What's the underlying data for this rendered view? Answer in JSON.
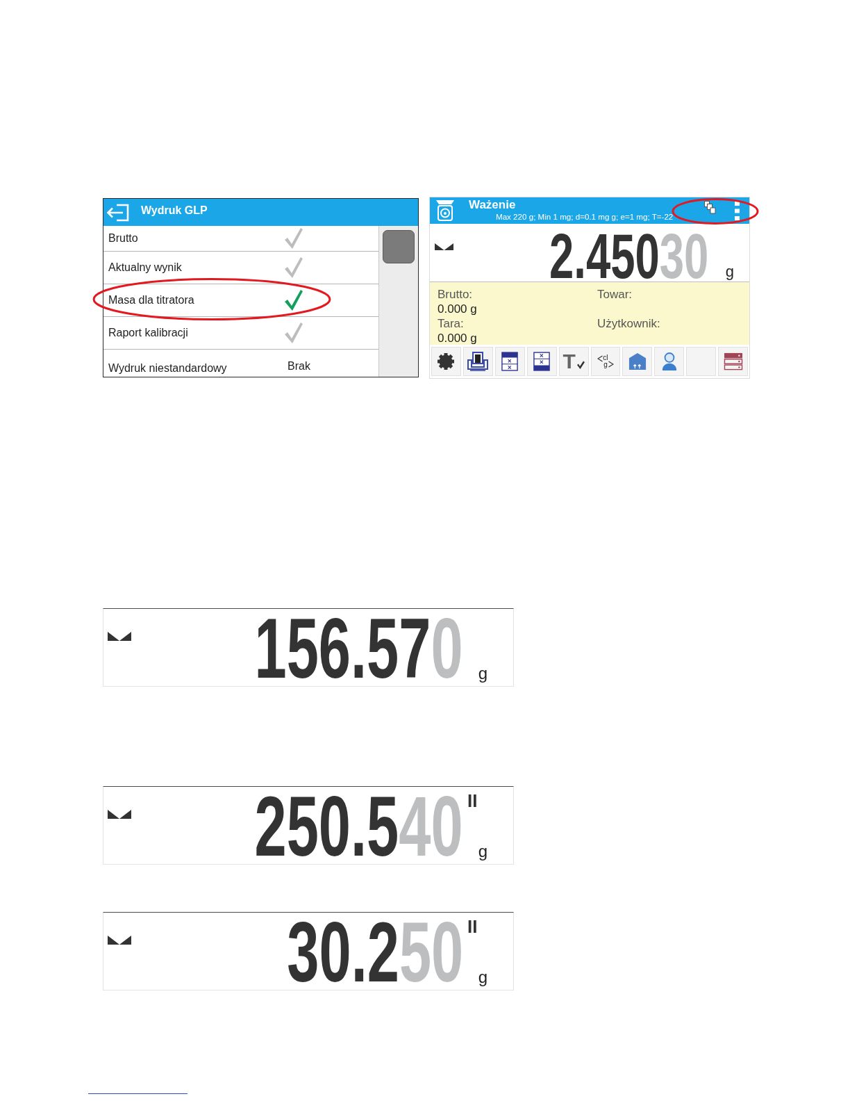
{
  "glp_screen": {
    "title": "Wydruk GLP",
    "items": [
      {
        "kind": "check",
        "label": "Brutto",
        "checked": false,
        "highlighted": false
      },
      {
        "kind": "check",
        "label": "Aktualny wynik",
        "checked": false,
        "highlighted": false
      },
      {
        "kind": "check",
        "label": "Masa dla titratora",
        "checked": true,
        "highlighted": true
      },
      {
        "kind": "check",
        "label": "Raport kalibracji",
        "checked": false,
        "highlighted": false
      },
      {
        "kind": "value",
        "label": "Wydruk niestandardowy",
        "value": "Brak",
        "highlighted": false
      }
    ]
  },
  "weighing_screen": {
    "title": "Ważenie",
    "subtitle": "Max 220 g; Min 1 mg; d=0.1 mg g; e=1 mg; T=-22",
    "header_icons_highlighted": true,
    "reading": {
      "main": "2.450",
      "extra": "30",
      "unit": "g"
    },
    "info": [
      {
        "label": "Brutto:",
        "value": "0.000 g"
      },
      {
        "label": "Towar:"
      },
      {
        "label": "Tara:",
        "value": "0.000 g"
      },
      {
        "label": "Użytkownik:"
      }
    ],
    "toolbar": [
      {
        "kind": "gear"
      },
      {
        "kind": "device"
      },
      {
        "kind": "panel-top"
      },
      {
        "kind": "panel-bottom"
      },
      {
        "kind": "tare",
        "label": "T"
      },
      {
        "kind": "units",
        "top": "cl",
        "bottom": "g"
      },
      {
        "kind": "package"
      },
      {
        "kind": "user"
      },
      {
        "kind": "blank"
      },
      {
        "kind": "server"
      }
    ]
  },
  "displays": [
    {
      "main": "156.57",
      "extra": "0",
      "unit": "g"
    },
    {
      "main": "250.5",
      "extra": "40",
      "range": "II",
      "unit": "g"
    },
    {
      "main": "30.2",
      "extra": "50",
      "range": "II",
      "unit": "g"
    }
  ]
}
